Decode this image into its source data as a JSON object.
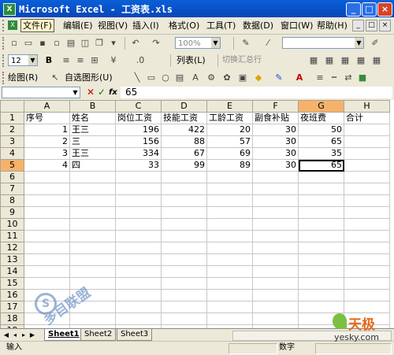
{
  "window": {
    "title": "Microsoft Excel - 工资表.xls",
    "controls": [
      "_",
      "□",
      "×"
    ]
  },
  "menu": {
    "items": [
      "文件(F)",
      "编辑(E)",
      "视图(V)",
      "插入(I)",
      "格式(O)",
      "工具(T)",
      "数据(D)",
      "窗口(W)",
      "帮助(H)"
    ],
    "active_index": 0
  },
  "standard_toolbar": {
    "zoom": "100%"
  },
  "format_toolbar": {
    "font_size": "12",
    "bold": "B",
    "list_label": "列表(L)",
    "toggle_total": "切换汇总行"
  },
  "draw_toolbar": {
    "draw_label": "绘图(R)",
    "autoshapes_label": "自选图形(U)"
  },
  "formula_bar": {
    "cancel": "✕",
    "enter": "✓",
    "fx": "fx",
    "value": "65"
  },
  "grid": {
    "columns": [
      "A",
      "B",
      "C",
      "D",
      "E",
      "F",
      "G",
      "H"
    ],
    "selected_column": "G",
    "selected_row": 5,
    "rows": [
      [
        "序号",
        "姓名",
        "岗位工资",
        "技能工资",
        "工龄工资",
        "副食补贴",
        "夜班费",
        "合计"
      ],
      [
        "1",
        "王三",
        "196",
        "422",
        "20",
        "30",
        "50",
        ""
      ],
      [
        "2",
        "三",
        "156",
        "88",
        "57",
        "30",
        "65",
        ""
      ],
      [
        "3",
        "王三",
        "334",
        "67",
        "69",
        "30",
        "35",
        ""
      ],
      [
        "4",
        "四",
        "33",
        "99",
        "89",
        "30",
        "65",
        ""
      ],
      [
        "",
        "",
        "",
        "",
        "",
        "",
        "",
        ""
      ],
      [
        "",
        "",
        "",
        "",
        "",
        "",
        "",
        ""
      ],
      [
        "",
        "",
        "",
        "",
        "",
        "",
        "",
        ""
      ],
      [
        "",
        "",
        "",
        "",
        "",
        "",
        "",
        ""
      ],
      [
        "",
        "",
        "",
        "",
        "",
        "",
        "",
        ""
      ],
      [
        "",
        "",
        "",
        "",
        "",
        "",
        "",
        ""
      ],
      [
        "",
        "",
        "",
        "",
        "",
        "",
        "",
        ""
      ],
      [
        "",
        "",
        "",
        "",
        "",
        "",
        "",
        ""
      ],
      [
        "",
        "",
        "",
        "",
        "",
        "",
        "",
        ""
      ],
      [
        "",
        "",
        "",
        "",
        "",
        "",
        "",
        ""
      ],
      [
        "",
        "",
        "",
        "",
        "",
        "",
        "",
        ""
      ],
      [
        "",
        "",
        "",
        "",
        "",
        "",
        "",
        ""
      ],
      [
        "",
        "",
        "",
        "",
        "",
        "",
        "",
        ""
      ],
      [
        "",
        "",
        "",
        "",
        "",
        "",
        "",
        ""
      ]
    ]
  },
  "sheets": {
    "tabs": [
      "Sheet1",
      "Sheet2",
      "Sheet3"
    ],
    "active_index": 0
  },
  "status": {
    "left": "输入",
    "mode": "数字"
  },
  "watermarks": {
    "left_text": "多目联盟",
    "right_brand": "天极",
    "right_domain": "yesky.com"
  }
}
